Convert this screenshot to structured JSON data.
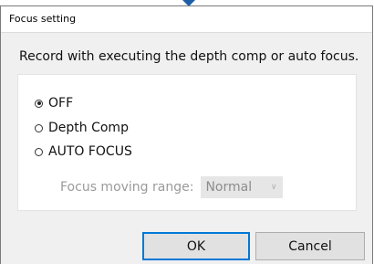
{
  "dialog": {
    "title": "Focus setting",
    "description": "Record with executing the depth comp or auto focus."
  },
  "options": [
    {
      "label": "OFF",
      "checked": true
    },
    {
      "label": "Depth Comp",
      "checked": false
    },
    {
      "label": "AUTO FOCUS",
      "checked": false
    }
  ],
  "focus_range": {
    "label": "Focus moving range:",
    "value": "Normal",
    "enabled": false
  },
  "buttons": {
    "ok": "OK",
    "cancel": "Cancel"
  },
  "colors": {
    "accent": "#0078d7",
    "pointer": "#1f5da8"
  }
}
